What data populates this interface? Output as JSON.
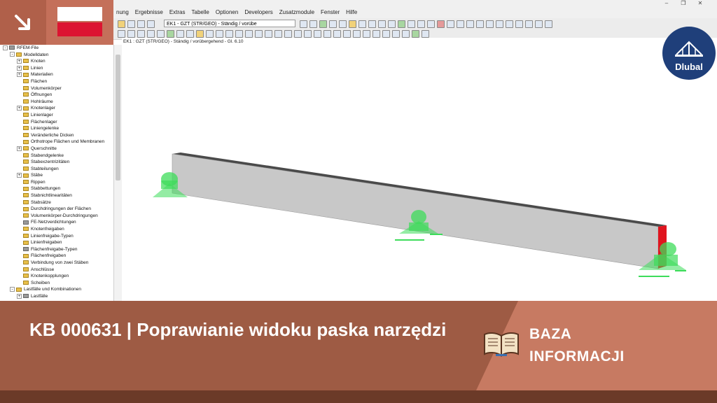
{
  "menu": {
    "items": [
      "nung",
      "Ergebnisse",
      "Extras",
      "Tabelle",
      "Optionen",
      "Developers",
      "Zusatzmodule",
      "Fenster",
      "Hilfe"
    ]
  },
  "toolbar": {
    "loadcase_select": "EK1 - GZT (STR/GEO) - Ständig / vorübe"
  },
  "navigator": {
    "items": [
      {
        "label": "RFEM-File",
        "level": 0,
        "expander": "-",
        "icon": "grey"
      },
      {
        "label": "Modelldaten",
        "level": 1,
        "expander": "-",
        "icon": "folder"
      },
      {
        "label": "Knoten",
        "level": 2,
        "expander": "+",
        "icon": "folder"
      },
      {
        "label": "Linien",
        "level": 2,
        "expander": "+",
        "icon": "folder"
      },
      {
        "label": "Materialien",
        "level": 2,
        "expander": "+",
        "icon": "folder"
      },
      {
        "label": "Flächen",
        "level": 2,
        "expander": "",
        "icon": "folder"
      },
      {
        "label": "Volumenkörper",
        "level": 2,
        "expander": "",
        "icon": "folder"
      },
      {
        "label": "Öffnungen",
        "level": 2,
        "expander": "",
        "icon": "folder"
      },
      {
        "label": "Hohlräume",
        "level": 2,
        "expander": "",
        "icon": "folder"
      },
      {
        "label": "Knotenlager",
        "level": 2,
        "expander": "+",
        "icon": "folder"
      },
      {
        "label": "Linienlager",
        "level": 2,
        "expander": "",
        "icon": "folder"
      },
      {
        "label": "Flächenlager",
        "level": 2,
        "expander": "",
        "icon": "folder"
      },
      {
        "label": "Liniengelenke",
        "level": 2,
        "expander": "",
        "icon": "folder"
      },
      {
        "label": "Veränderliche Dicken",
        "level": 2,
        "expander": "",
        "icon": "folder"
      },
      {
        "label": "Orthotrope Flächen und Membranen",
        "level": 2,
        "expander": "",
        "icon": "folder"
      },
      {
        "label": "Querschnitte",
        "level": 2,
        "expander": "+",
        "icon": "folder"
      },
      {
        "label": "Stabendgelenke",
        "level": 2,
        "expander": "",
        "icon": "folder"
      },
      {
        "label": "Stabexzentrizitäten",
        "level": 2,
        "expander": "",
        "icon": "folder"
      },
      {
        "label": "Stabteilungen",
        "level": 2,
        "expander": "",
        "icon": "folder"
      },
      {
        "label": "Stäbe",
        "level": 2,
        "expander": "+",
        "icon": "folder"
      },
      {
        "label": "Rippen",
        "level": 2,
        "expander": "",
        "icon": "folder"
      },
      {
        "label": "Stabbettungen",
        "level": 2,
        "expander": "",
        "icon": "folder"
      },
      {
        "label": "Stabnichtlinearitäten",
        "level": 2,
        "expander": "",
        "icon": "folder"
      },
      {
        "label": "Stabsätze",
        "level": 2,
        "expander": "",
        "icon": "folder"
      },
      {
        "label": "Durchdringungen der Flächen",
        "level": 2,
        "expander": "",
        "icon": "folder"
      },
      {
        "label": "Volumenkörper-Durchdringungen",
        "level": 2,
        "expander": "",
        "icon": "folder"
      },
      {
        "label": "FE-Netzverdichtungen",
        "level": 2,
        "expander": "",
        "icon": "grey"
      },
      {
        "label": "Knotenfreigaben",
        "level": 2,
        "expander": "",
        "icon": "folder"
      },
      {
        "label": "Linienfreigabe-Typen",
        "level": 2,
        "expander": "",
        "icon": "folder"
      },
      {
        "label": "Linienfreigaben",
        "level": 2,
        "expander": "",
        "icon": "folder"
      },
      {
        "label": "Flächenfreigabe-Typen",
        "level": 2,
        "expander": "",
        "icon": "grey"
      },
      {
        "label": "Flächenfreigaben",
        "level": 2,
        "expander": "",
        "icon": "folder"
      },
      {
        "label": "Verbindung von zwei Stäben",
        "level": 2,
        "expander": "",
        "icon": "folder"
      },
      {
        "label": "Anschlüsse",
        "level": 2,
        "expander": "",
        "icon": "folder"
      },
      {
        "label": "Knotenkopplungen",
        "level": 2,
        "expander": "",
        "icon": "folder"
      },
      {
        "label": "Scheiben",
        "level": 2,
        "expander": "",
        "icon": "folder"
      },
      {
        "label": "Lastfälle und Kombinationen",
        "level": 1,
        "expander": "-",
        "icon": "folder"
      },
      {
        "label": "Lastfälle",
        "level": 2,
        "expander": "+",
        "icon": "grey"
      }
    ]
  },
  "viewport": {
    "caption": "EK1 : GZT (STR/GEO) - Ständig / vorübergehend - Gl. 6.10"
  },
  "logo": {
    "text": "Dlubal"
  },
  "banner": {
    "title": "KB 000631 | Poprawianie widoku paska narzędzi",
    "label_line1": "BAZA",
    "label_line2": "INFORMACJI"
  },
  "colors": {
    "banner": "#9e5b44",
    "banner_accent": "#c77a62",
    "flag_red": "#dc1431",
    "logo_blue": "#1f3f7a",
    "support_green": "#3ddc5a",
    "beam_end_red": "#e0141e"
  },
  "icons": {
    "badge": "arrow-down-right-icon",
    "book": "open-book-icon",
    "logo": "bridge-icon"
  }
}
